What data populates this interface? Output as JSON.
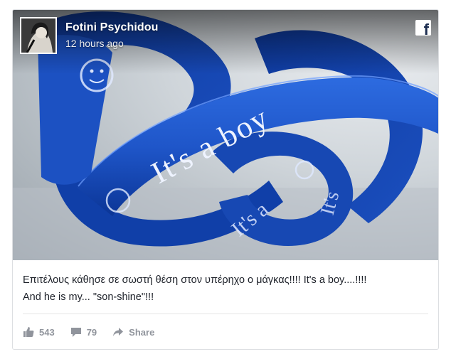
{
  "post": {
    "author": "Fotini Psychidou",
    "timestamp": "12 hours ago",
    "text_line1": "Επιτέλους κάθησε σε σωστή θέση στον υπέρηχο ο μάγκας!!!! It's a boy....!!!!",
    "text_line2": "And he is my... \"son-shine\"!!!",
    "ribbon_texts": [
      "It's a boy",
      "It's a",
      "It's"
    ]
  },
  "actions": {
    "likes": "543",
    "comments": "79",
    "share_label": "Share"
  },
  "icons": {
    "facebook": "facebook-icon",
    "like": "thumbs-up-icon",
    "comment": "comment-icon",
    "share": "share-arrow-icon"
  },
  "colors": {
    "ribbon_blue": "#1f56c9",
    "ribbon_dark": "#0b2f86",
    "action_gray": "#90949c",
    "text": "#1d2129"
  }
}
